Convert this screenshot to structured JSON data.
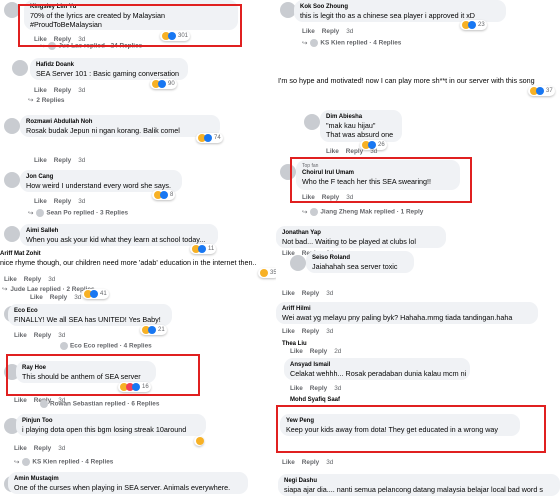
{
  "left": {
    "c1": {
      "name": "Kingsley Lim Yu",
      "lines": [
        "70% of the lyrics are created by Malaysian",
        "#ProudToBeMalaysian"
      ],
      "time": "3d",
      "count": "301",
      "replies": "Jue Lae replied · 24 Replies"
    },
    "c2": {
      "name": "Hafidz Doank",
      "lines": [
        "SEA Server 101 : Basic gaming conversation"
      ],
      "time": "3d",
      "count": "90",
      "replies": "2 Replies"
    },
    "c3": {
      "name": "Rozmawi Abdullah Noh",
      "lines": [
        "Rosak budak Jepun ni ngan korang. Balik comel"
      ],
      "time": "3d",
      "count": "74"
    },
    "c4": {
      "name": "Jon Cang",
      "lines": [
        "How weird I understand every word she says."
      ],
      "time": "3d",
      "count": "8",
      "replies": "Sean Po replied · 3 Replies"
    },
    "c5": {
      "name": "Aimi Salleh",
      "lines": [
        "When you ask your kid what they learn at school today..."
      ],
      "time": "3d",
      "count": "11"
    },
    "c6": {
      "name": "Ariff Mat Zohit",
      "lines": [
        "nice rhyme though, our children need more 'adab' education in the internet then.."
      ],
      "time": "3d",
      "count": "35",
      "replies": "Jude Lae replied · 2 Replies"
    },
    "c6b": {
      "time": "3d",
      "count": "41"
    },
    "c7": {
      "name": "Eco Eco",
      "lines": [
        "FINALLY! We all SEA has UNITED! Yes Baby!"
      ],
      "time": "3d",
      "count": "21",
      "replies": "Eco Eco replied · 4 Replies"
    },
    "c8": {
      "name": "Ray Hoe",
      "lines": [
        "This should be anthem of SEA server"
      ],
      "time": "3d",
      "count": "16",
      "replies": "Rowan Sebastian replied · 6 Replies"
    },
    "c9": {
      "name": "Pinjun Too",
      "lines": [
        "i playing dota open this bgm losing streak 10around"
      ],
      "time": "3d",
      "count": "",
      "replies": "KS Kien replied · 4 Replies"
    },
    "c10": {
      "name": "Amin Mustaqim",
      "lines": [
        "One of the curses when playing in SEA server. Animals everywhere."
      ]
    },
    "like": "Like",
    "reply": "Reply"
  },
  "right": {
    "c1": {
      "name": "Kok Soo Zhoung",
      "lines": [
        "this is legit tho as a chinese sea player i approved it xD"
      ],
      "time": "3d",
      "count": "23",
      "replies": "KS Kien replied · 4 Replies"
    },
    "c2": {
      "lines": [
        "I'm so hype and motivated! now I can play more sh**t in our server with this song"
      ],
      "count": "37"
    },
    "c3": {
      "name": "Dim Abiesha",
      "lines": [
        "\"mak kau hijau\"",
        "That was absurd one"
      ],
      "time": "3d",
      "count": "26"
    },
    "c4": {
      "badge": "Top fan",
      "name": "Choirul Irul Umam",
      "lines": [
        "Who the F teach her this SEA swearing!!"
      ],
      "time": "3d",
      "replies": "Jiang Zheng Mak replied · 1 Reply"
    },
    "c5": {
      "name": "Jonathan Yap",
      "lines": [
        "Not bad... Waiting to be played at clubs lol"
      ],
      "time": "3d"
    },
    "c6": {
      "name": "Seiso Roland",
      "lines": [
        "Jaiahahah sea server toxic"
      ],
      "time": "3d"
    },
    "c7": {
      "name": "Ariff Hilmi",
      "lines": [
        "Wei awat yg melayu pny paling byk? Hahaha.mmg tiada tandingan.haha"
      ],
      "time": "3d"
    },
    "c8": {
      "name": "Thea Liu",
      "time": "2d"
    },
    "c9": {
      "name": "Ansyad Ismail",
      "lines": [
        "Celakat wehhh... Rosak peradaban dunia kalau mcm ni"
      ],
      "time": "3d"
    },
    "c10": {
      "name": "Mohd Syafiq Saaf"
    },
    "c11": {
      "name": "Yew Peng",
      "lines": [
        "Keep your kids away from dota! They get educated in a wrong way"
      ],
      "time": "3d"
    },
    "c12": {
      "name": "Negi Dashu",
      "lines": [
        "siapa ajar dia.... nanti semua pelancong datang malaysia belajar local bad word s"
      ]
    },
    "like": "Like",
    "reply": "Reply"
  },
  "colors": {
    "highlight": "#e02020",
    "bubble": "#f0f2f5",
    "meta": "#65676b"
  }
}
